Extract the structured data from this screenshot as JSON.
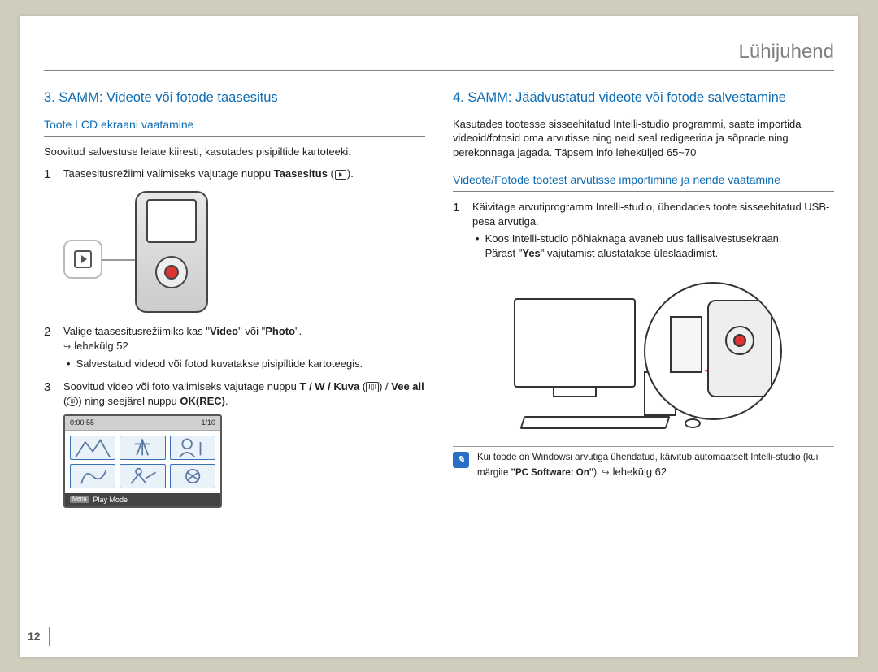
{
  "doc": {
    "title": "Lühijuhend",
    "page_number": "12"
  },
  "left": {
    "heading": "3. SAMM: Videote või fotode taasesitus",
    "subheading": "Toote LCD ekraani vaatamine",
    "intro": "Soovitud salvestuse leiate kiiresti, kasutades pisipiltide kartoteeki.",
    "step1_a": "Taasesitusrežiimi valimiseks vajutage nuppu ",
    "step1_b_bold": "Taasesitus",
    "step1_c": " (",
    "step1_d": ").",
    "step2_a": "Valige taasesitusrežiimiks kas \"",
    "step2_b_bold1": "Video",
    "step2_c": "\" või \"",
    "step2_d_bold2": "Photo",
    "step2_e": "\".",
    "step2_ref": "lehekülg 52",
    "step2_bullet": "Salvestatud videod või fotod kuvatakse pisipiltide kartoteegis.",
    "step3_a": "Soovitud video või foto valimiseks vajutage nuppu ",
    "step3_b_bold": "T / W / Kuva",
    "step3_c": " (",
    "step3_d": ") / ",
    "step3_e_bold": "Vee all",
    "step3_f": " (",
    "step3_g": ") ning seejärel nuppu ",
    "step3_h_bold": "OK(REC)",
    "step3_i": ".",
    "thumbs": {
      "time": "0:00:55",
      "counter": "1/10",
      "menu": "Menu",
      "mode": "Play Mode"
    }
  },
  "right": {
    "heading": "4. SAMM: Jäädvustatud videote või fotode salvestamine",
    "intro": "Kasutades tootesse sisseehitatud Intelli-studio programmi, saate importida videoid/fotosid oma arvutisse ning neid seal redigeerida ja sõprade ning perekonnaga jagada. Täpsem info leheküljed 65~70",
    "subheading": "Videote/Fotode tootest arvutisse importimine ja nende vaatamine",
    "step1": "Käivitage arvutiprogramm Intelli-studio, ühendades toote sisseehitatud USB-pesa arvutiga.",
    "bullet1": "Koos Intelli-studio põhiaknaga avaneb uus failisalvestusekraan.",
    "bullet1b_a": "Pärast \"",
    "bullet1b_bold": "Yes",
    "bullet1b_b": "\" vajutamist alustatakse üleslaadimist.",
    "note_a": "Kui toode on Windowsi arvutiga ühendatud, käivitub automaatselt Intelli-studio (kui märgite ",
    "note_bold": "\"PC Software: On\"",
    "note_b": "). ",
    "note_ref": "lehekülg 62"
  }
}
